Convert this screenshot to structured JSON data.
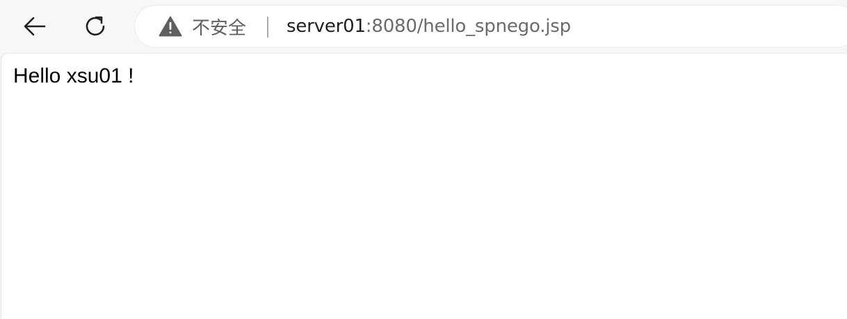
{
  "toolbar": {
    "back_icon": "arrow-left-icon",
    "reload_icon": "reload-icon"
  },
  "addressbar": {
    "security_icon": "warning-triangle-icon",
    "security_label": "不安全",
    "url_host": "server01",
    "url_rest": ":8080/hello_spnego.jsp"
  },
  "page": {
    "greeting": "Hello xsu01 !"
  }
}
